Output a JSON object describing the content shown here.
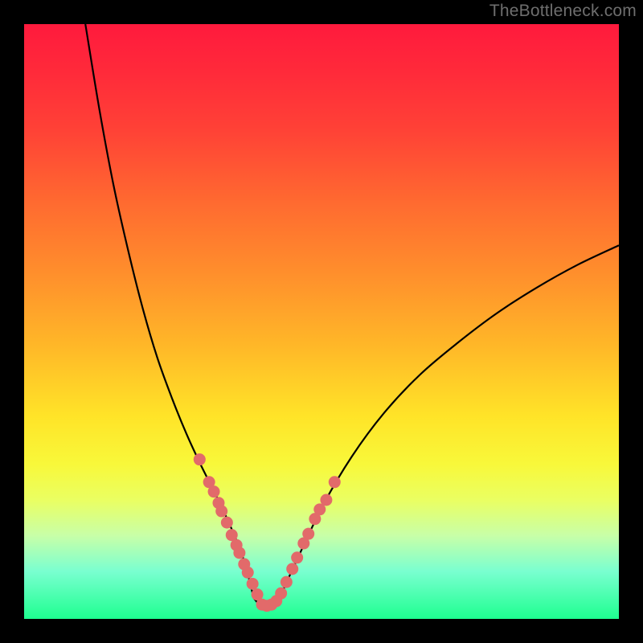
{
  "watermark": "TheBottleneck.com",
  "colors": {
    "frame": "#000000",
    "curve": "#000000",
    "marker_fill": "#e26a6a",
    "marker_stroke": "#b34747"
  },
  "chart_data": {
    "type": "line",
    "title": "",
    "xlabel": "",
    "ylabel": "",
    "xlim": [
      0,
      100
    ],
    "ylim": [
      0,
      100
    ],
    "grid": false,
    "legend": false,
    "series": [
      {
        "name": "bottleneck-curve-left",
        "x": [
          10.3,
          12.7,
          15.1,
          17.6,
          20.0,
          22.4,
          24.9,
          27.3,
          29.7,
          32.4,
          34.9,
          37.0,
          38.6
        ],
        "y": [
          100.0,
          85.4,
          72.6,
          61.5,
          52.0,
          43.9,
          37.0,
          31.1,
          25.9,
          20.5,
          15.1,
          9.7,
          3.5
        ]
      },
      {
        "name": "bottleneck-curve-floor",
        "x": [
          38.6,
          40.0,
          41.4,
          42.7
        ],
        "y": [
          3.5,
          2.0,
          2.0,
          3.0
        ]
      },
      {
        "name": "bottleneck-curve-right",
        "x": [
          42.7,
          45.9,
          50.3,
          55.1,
          60.5,
          66.6,
          73.0,
          79.5,
          86.2,
          93.0,
          100.0
        ],
        "y": [
          3.0,
          10.0,
          19.2,
          27.3,
          34.6,
          41.1,
          46.5,
          51.4,
          55.7,
          59.5,
          62.8
        ]
      }
    ],
    "markers": [
      {
        "name": "highlight-dots",
        "shape": "circle",
        "x": [
          29.5,
          31.1,
          31.9,
          32.7,
          33.2,
          34.1,
          34.9,
          35.7,
          36.2,
          37.0,
          37.6,
          38.4,
          39.2,
          40.0,
          40.8,
          41.6,
          42.4,
          43.2,
          44.1,
          45.1,
          45.9,
          47.0,
          47.8,
          48.9,
          49.7,
          50.8,
          52.2
        ],
        "y": [
          26.8,
          23.0,
          21.4,
          19.5,
          18.1,
          16.2,
          14.1,
          12.4,
          11.1,
          9.2,
          7.8,
          5.9,
          4.1,
          2.4,
          2.2,
          2.4,
          3.0,
          4.3,
          6.2,
          8.4,
          10.3,
          12.7,
          14.3,
          16.8,
          18.4,
          20.0,
          23.0
        ]
      }
    ]
  }
}
